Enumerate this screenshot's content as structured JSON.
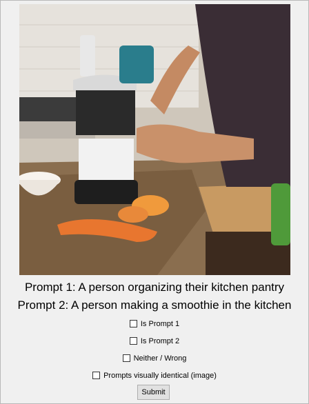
{
  "image": {
    "alt_icon": "photo-kitchen-smoothie"
  },
  "prompts": {
    "prompt1": "Prompt 1: A person organizing their kitchen pantry",
    "prompt2": "Prompt 2: A person making a smoothie in the kitchen"
  },
  "options": [
    {
      "label": "Is Prompt 1",
      "checked": false
    },
    {
      "label": "Is Prompt 2",
      "checked": false
    },
    {
      "label": "Neither / Wrong",
      "checked": false
    },
    {
      "label": "Prompts visually identical (image)",
      "checked": false
    }
  ],
  "submit_label": "Submit"
}
